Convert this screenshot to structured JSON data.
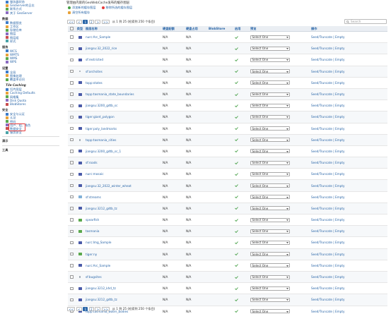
{
  "colors": {
    "accent": "#2a66a8",
    "check": "#46a046",
    "highlight": "#e53b3b",
    "layer_icon": "#4a5aa8",
    "group_icon": "#9aa3ad",
    "raster_icon": "#5aa84c"
  },
  "sidebar": {
    "top_items": [
      {
        "label": "服务器状态",
        "icon": "info-icon"
      },
      {
        "label": "GeoServer的日志",
        "icon": "log-icon"
      },
      {
        "label": "联系方式",
        "icon": "contact-icon"
      },
      {
        "label": "关于 GeoServer",
        "icon": "about-icon"
      }
    ],
    "data_head": "数据",
    "data_items": [
      {
        "label": "数据预览",
        "icon": "preview-icon"
      },
      {
        "label": "工作区",
        "icon": "workspace-icon"
      },
      {
        "label": "存储仓库",
        "icon": "store-icon"
      },
      {
        "label": "图层",
        "icon": "layer-icon"
      },
      {
        "label": "图层组",
        "icon": "layergroup-icon"
      },
      {
        "label": "样式",
        "icon": "style-icon"
      }
    ],
    "services_head": "服务",
    "services_items": [
      {
        "label": "WCS",
        "icon": "wcs-icon"
      },
      {
        "label": "WMTS",
        "icon": "wmts-icon"
      },
      {
        "label": "WMS",
        "icon": "wms-icon"
      },
      {
        "label": "WPS",
        "icon": "wps-icon"
      }
    ],
    "settings_head": "设置",
    "settings_items": [
      {
        "label": "全局",
        "icon": "global-icon"
      },
      {
        "label": "图像处理",
        "icon": "jai-icon"
      },
      {
        "label": "覆盖率访问",
        "icon": "coverage-icon"
      }
    ],
    "tile_head": "Tile Caching",
    "tile_items": [
      {
        "label": "切片图层",
        "icon": "tile-layers-icon"
      },
      {
        "label": "Caching Defaults",
        "icon": "caching-defaults-icon"
      },
      {
        "label": "网格集",
        "icon": "gridsets-icon"
      },
      {
        "label": "Disk Quota",
        "icon": "disk-quota-icon"
      },
      {
        "label": "BlobStores",
        "icon": "blobstores-icon"
      }
    ],
    "security_head": "安全",
    "security_items": [
      {
        "label": "安全与认证",
        "icon": "security-icon"
      },
      {
        "label": "认证",
        "icon": "auth-icon"
      },
      {
        "label": "密码",
        "icon": "password-icon"
      },
      {
        "label": "用户、组、角色",
        "icon": "users-icon"
      },
      {
        "label": "数据安全",
        "icon": "data-security-icon"
      },
      {
        "label": "服务安全",
        "icon": "service-security-icon"
      }
    ],
    "demo_head": "演示",
    "tools_head": "工具"
  },
  "main": {
    "title": "管理由内嵌的GeoWebCache发布的缓存图层",
    "add_link": "添加新的缓存图层",
    "remove_link": "移除所选的缓存图层",
    "empty_link": "清空所有缓存",
    "pager": {
      "first": "<<",
      "prev": "<",
      "pages": [
        "1",
        "2",
        ">",
        ">>"
      ],
      "info": "从 1 到 25 (检索到 250 个条目)",
      "bottom_info": "从 1 到 25 (检索到 250 个条目)"
    },
    "search_placeholder": "Search",
    "columns": {
      "type": "类型",
      "name": "图层名称",
      "disk": "硬盘配额",
      "disk_used": "硬盘占用",
      "blobstore": "BlobStore",
      "enabled": "启用",
      "preview": "预览",
      "actions": "操作"
    },
    "select_label": "Select One",
    "actions_label": "Seed/Truncate | Empty",
    "rows": [
      {
        "name": "nurc:Arc_Sample",
        "type": "layer"
      },
      {
        "name": "jiangsu:32_2022_rice",
        "type": "layer"
      },
      {
        "name": "sf:restricted",
        "type": "layer"
      },
      {
        "name": "sf:archsites",
        "type": "point"
      },
      {
        "name": "topp:states",
        "type": "layer"
      },
      {
        "name": "topp:tasmania_state_boundaries",
        "type": "layer"
      },
      {
        "name": "jiangsu:3200_gdtb_sc",
        "type": "layer"
      },
      {
        "name": "tiger:giant_polygon",
        "type": "layer"
      },
      {
        "name": "tiger:poly_landmarks",
        "type": "layer"
      },
      {
        "name": "topp:tasmania_cities",
        "type": "point"
      },
      {
        "name": "jiangsu:3200_gdtb_sc_1",
        "type": "layer"
      },
      {
        "name": "sf:roads",
        "type": "layer"
      },
      {
        "name": "nurc:mosaic",
        "type": "layer"
      },
      {
        "name": "jiangsu:32_2022_winter_wheat",
        "type": "layer"
      },
      {
        "name": "sf:streams",
        "type": "line"
      },
      {
        "name": "jiangsu:3212_gdtb_tz",
        "type": "layer"
      },
      {
        "name": "spearfish",
        "type": "raster"
      },
      {
        "name": "tasmania",
        "type": "raster"
      },
      {
        "name": "nurc:Img_Sample",
        "type": "layer"
      },
      {
        "name": "tiger:ny",
        "type": "raster"
      },
      {
        "name": "nurc:Arc_Sample",
        "type": "layer"
      },
      {
        "name": "sf:bugsites",
        "type": "point"
      },
      {
        "name": "jiangsu:3212_khd_tz",
        "type": "layer"
      },
      {
        "name": "jiangsu:3212_gdtb_tz",
        "type": "layer"
      },
      {
        "name": "topp:tasmania_water_bodies",
        "type": "layer"
      }
    ],
    "na": "N/A"
  }
}
